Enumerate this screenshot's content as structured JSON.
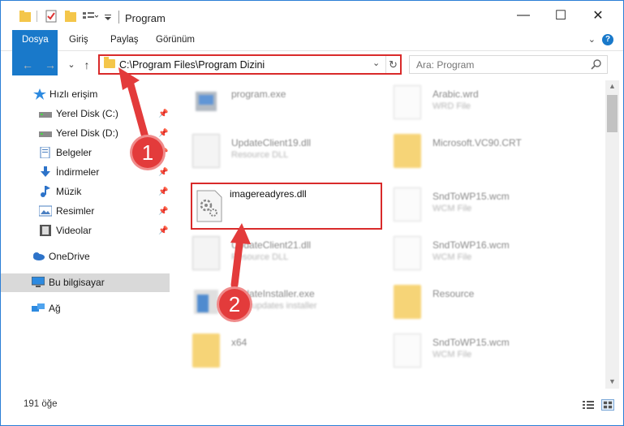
{
  "window": {
    "title": "Program",
    "min_glyph": "—",
    "max_glyph": "☐",
    "close_glyph": "✕"
  },
  "ribbon": {
    "tabs": [
      "Dosya",
      "Giriş",
      "Paylaş",
      "Görünüm"
    ],
    "help": "?",
    "collapse_glyph": "⌄"
  },
  "nav_buttons": {
    "back": "←",
    "forward": "→",
    "recent": "⌄",
    "up": "↑"
  },
  "address": {
    "path": "C:\\Program Files\\Program Dizini",
    "dropdown_glyph": "⌄",
    "refresh_glyph": "↻"
  },
  "search": {
    "placeholder": "Ara: Program"
  },
  "sidebar": {
    "items": [
      {
        "label": "Hızlı erişim",
        "icon": "star-icon"
      },
      {
        "label": "Yerel Disk (C:)",
        "icon": "drive-icon",
        "pinned": true
      },
      {
        "label": "Yerel Disk (D:)",
        "icon": "drive-icon",
        "pinned": true
      },
      {
        "label": "Belgeler",
        "icon": "documents-icon",
        "pinned": true
      },
      {
        "label": "İndirmeler",
        "icon": "download-icon",
        "pinned": true
      },
      {
        "label": "Müzik",
        "icon": "music-icon",
        "pinned": true
      },
      {
        "label": "Resimler",
        "icon": "pictures-icon",
        "pinned": true
      },
      {
        "label": "Videolar",
        "icon": "videos-icon",
        "pinned": true
      },
      {
        "label": "OneDrive",
        "icon": "cloud-icon"
      },
      {
        "label": "Bu bilgisayar",
        "icon": "computer-icon",
        "selected": true
      },
      {
        "label": "Ağ",
        "icon": "network-icon"
      }
    ],
    "pin_glyph": "📌"
  },
  "files": [
    {
      "name": "program.exe",
      "sub": "",
      "icon": "exe-icon"
    },
    {
      "name": "Arabic.wrd",
      "sub": "WRD File",
      "icon": "document-icon"
    },
    {
      "name": "UpdateClient19.dll",
      "sub": "Resource DLL",
      "icon": "dll-icon"
    },
    {
      "name": "Microsoft.VC90.CRT",
      "sub": "",
      "icon": "folder-icon"
    },
    {
      "name": "imagereadyres.dll",
      "sub": "",
      "icon": "dll-icon"
    },
    {
      "name": "SndToWP15.wcm",
      "sub": "WCM File",
      "icon": "document-icon"
    },
    {
      "name": "UpdateClient21.dll",
      "sub": "Resource DLL",
      "icon": "dll-icon"
    },
    {
      "name": "SndToWP16.wcm",
      "sub": "WCM File",
      "icon": "document-icon"
    },
    {
      "name": "UpdateInstaller.exe",
      "sub": "UDT updates installer",
      "icon": "installer-icon"
    },
    {
      "name": "Resource",
      "sub": "",
      "icon": "folder-icon"
    },
    {
      "name": "x64",
      "sub": "",
      "icon": "folder-icon"
    },
    {
      "name": "SndToWP15.wcm",
      "sub": "WCM File",
      "icon": "document-icon"
    }
  ],
  "status": {
    "count": "191 öğe"
  },
  "annotations": {
    "step1": "1",
    "step2": "2",
    "accent_color": "#e33b3b"
  }
}
